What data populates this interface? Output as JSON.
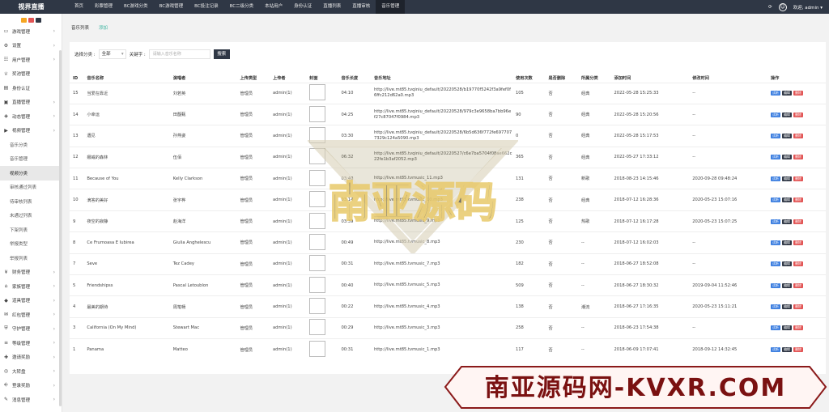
{
  "app": {
    "title": "视界直播",
    "user": "欢迎, admin"
  },
  "nav": [
    "首页",
    "彩票管理",
    "BC游戏分类",
    "BC游戏管理",
    "BC投注记录",
    "BC二级分类",
    "本站用户",
    "身份认证",
    "直播列表",
    "直播审核",
    "音乐管理"
  ],
  "sidebar": [
    {
      "label": "游戏管理",
      "icon": "monitor-icon",
      "arrow": true
    },
    {
      "label": "设置",
      "icon": "gear-icon",
      "arrow": true
    },
    {
      "label": "用户管理",
      "icon": "users-icon",
      "arrow": true
    },
    {
      "label": "奖池管理",
      "icon": "trophy-icon",
      "arrow": false
    },
    {
      "label": "身份认证",
      "icon": "id-icon",
      "arrow": false
    },
    {
      "label": "直播管理",
      "icon": "tv-icon",
      "arrow": true
    },
    {
      "label": "动态管理",
      "icon": "dynamic-icon",
      "arrow": true
    },
    {
      "label": "视频管理",
      "icon": "video-icon",
      "arrow": true
    }
  ],
  "sidebar_sub": [
    "音乐分类",
    "音乐管理",
    "视频分类",
    "审核通过列表",
    "待审核列表",
    "未通过列表",
    "下架列表",
    "举报类型",
    "举报列表"
  ],
  "sidebar_active_sub": 2,
  "sidebar2": [
    {
      "label": "财务管理",
      "icon": "finance-icon"
    },
    {
      "label": "家族管理",
      "icon": "family-icon"
    },
    {
      "label": "道具管理",
      "icon": "prop-icon"
    },
    {
      "label": "红包管理",
      "icon": "redpacket-icon"
    },
    {
      "label": "守护管理",
      "icon": "guard-icon"
    },
    {
      "label": "等级管理",
      "icon": "level-icon"
    },
    {
      "label": "邀请奖励",
      "icon": "invite-icon"
    },
    {
      "label": "大转盘",
      "icon": "wheel-icon"
    },
    {
      "label": "登录奖励",
      "icon": "login-icon"
    },
    {
      "label": "消息管理",
      "icon": "message-icon"
    }
  ],
  "tabs": [
    "音乐列表",
    "添加"
  ],
  "filter": {
    "category_label": "选择分类 :",
    "category_value": "全部",
    "keyword_label": "关键字 :",
    "keyword_placeholder": "请输入音乐名称",
    "search": "搜索"
  },
  "columns": [
    "ID",
    "音乐名称",
    "演唱者",
    "上传类型",
    "上传者",
    "封面",
    "音乐长度",
    "音乐地址",
    "使用次数",
    "是否删除",
    "所属分类",
    "添加时间",
    "修改时间",
    "操作"
  ],
  "rows": [
    [
      "15",
      "当爱在靠近",
      "刘若英",
      "管理员",
      "admin(1)",
      "04:10",
      "http://live.mt85.tvqiniu_default/20220528/b19770f5242f3a9fef0f6ffc212d62a0.mp3",
      "105",
      "否",
      "经典",
      "2022-05-28 15:25:33",
      "--"
    ],
    [
      "14",
      "小幸运",
      "田馥甄",
      "管理员",
      "admin(1)",
      "04:25",
      "http://live.mt85.tvqiniu_default/20220528/979c3e9658ba7bb96ef27c87047f0984.mp3",
      "90",
      "否",
      "经典",
      "2022-05-28 15:20:56",
      "--"
    ],
    [
      "13",
      "遇见",
      "孙燕姿",
      "管理员",
      "admin(1)",
      "03:30",
      "http://live.mt85.tvqiniu_default/20220528/6b5d636f772fe6977077329c124a5090.mp3",
      "0",
      "否",
      "经典",
      "2022-05-28 15:17:53",
      "--"
    ],
    [
      "12",
      "娜威的森林",
      "伍佰",
      "管理员",
      "admin(1)",
      "06:32",
      "http://live.mt85.tvqiniu_default/20220527/c6e7ba5704f08ae662c22fe1b3af2052.mp3",
      "365",
      "否",
      "经典",
      "2022-05-27 17:33:12",
      "--"
    ],
    [
      "11",
      "Because of You",
      "Kelly Clarkson",
      "管理员",
      "admin(1)",
      "03:40",
      "http://live.mt85.tvmusic_11.mp3",
      "131",
      "否",
      "新歌",
      "2018-08-23 14:15:46",
      "2020-09-28 09:48:24"
    ],
    [
      "10",
      "滴答的美好",
      "张宇桦",
      "管理员",
      "admin(1)",
      "03:14",
      "http://live.mt85.tvmusic_10.mp3",
      "238",
      "否",
      "经典",
      "2018-07-12 16:28:36",
      "2020-05-23 15:07:16"
    ],
    [
      "9",
      "夜空的寂静",
      "赵海洋",
      "管理员",
      "admin(1)",
      "03:39",
      "http://live.mt85.tvmusic_9.mp3",
      "125",
      "否",
      "热歌",
      "2018-07-12 16:17:28",
      "2020-05-23 15:07:25"
    ],
    [
      "8",
      "Ce Frumoasa E Iubirea",
      "Giulia Anghelescu",
      "管理员",
      "admin(1)",
      "00:49",
      "http://live.mt85.tvmusic_8.mp3",
      "230",
      "否",
      "--",
      "2018-07-12 16:02:03",
      "--"
    ],
    [
      "7",
      "Seve",
      "Tez Cadey",
      "管理员",
      "admin(1)",
      "00:31",
      "http://live.mt85.tvmusic_7.mp3",
      "182",
      "否",
      "--",
      "2018-06-27 18:52:08",
      "--"
    ],
    [
      "5",
      "Friendshipss",
      "Pascal Letoublon",
      "管理员",
      "admin(1)",
      "00:40",
      "http://live.mt85.tvmusic_5.mp3",
      "509",
      "否",
      "--",
      "2018-06-27 18:30:32",
      "2019-09-04 11:52:46"
    ],
    [
      "4",
      "最美的期待",
      "周笔畅",
      "管理员",
      "admin(1)",
      "00:22",
      "http://live.mt85.tvmusic_4.mp3",
      "138",
      "否",
      "潮流",
      "2018-06-27 17:16:35",
      "2020-05-23 15:11:21"
    ],
    [
      "3",
      "California (On My Mind)",
      "Stewart Mac",
      "管理员",
      "admin(1)",
      "00:29",
      "http://live.mt85.tvmusic_3.mp3",
      "258",
      "否",
      "--",
      "2018-06-23 17:54:38",
      "--"
    ],
    [
      "1",
      "Panama",
      "Matteo",
      "管理员",
      "admin(1)",
      "00:31",
      "http://live.mt85.tvmusic_1.mp3",
      "117",
      "否",
      "--",
      "2018-06-09 17:07:41",
      "2018-09-12 14:32:45"
    ]
  ],
  "row_actions": [
    "试听",
    "编辑",
    "删除"
  ],
  "watermark": {
    "center": "南亚源码",
    "corner": "南亚源码网-KVXR.COM"
  },
  "colors": {
    "topbar": "#2f3745",
    "accent": "#3bb4a0",
    "listen": "#3d7fe0",
    "edit": "#2f3745",
    "delete": "#e25454"
  }
}
